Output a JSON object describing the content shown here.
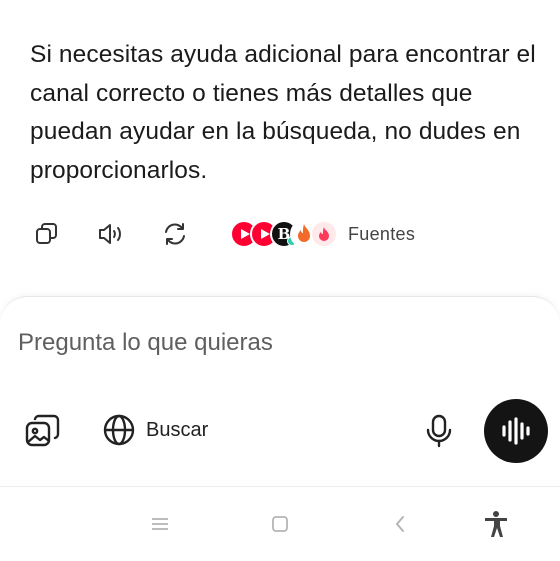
{
  "message": {
    "text": "Si necesitas ayuda adicional para encontrar el canal correcto o tienes más detalles que puedan ayudar en la búsqueda, no dudes en proporcionarlos."
  },
  "actions": {
    "copy_icon": "copy-icon",
    "read_aloud_icon": "speaker-icon",
    "regenerate_icon": "refresh-icon",
    "sources_label": "Fuentes",
    "source_icons": [
      "youtube-icon",
      "youtube-icon",
      "b-letter-icon",
      "fire-icon",
      "tinder-icon"
    ]
  },
  "composer": {
    "placeholder": "Pregunta lo que quieras",
    "search_label": "Buscar"
  },
  "colors": {
    "text": "#1b1b1b",
    "voice_button": "#141414",
    "youtube": "#ff0033",
    "fire": "#f26b2a",
    "tinder": "#fd3a5a"
  }
}
